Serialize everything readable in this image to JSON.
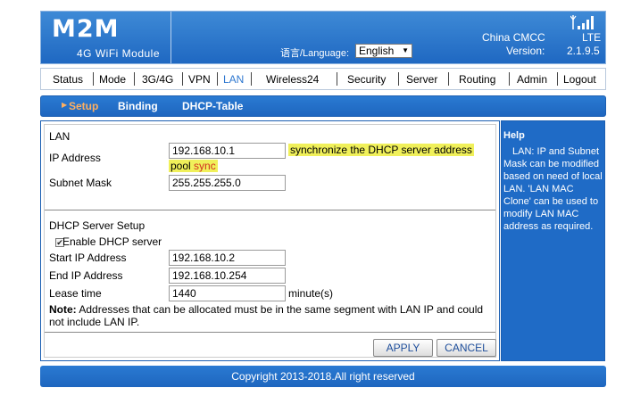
{
  "header": {
    "logo": "M2M",
    "logo_sub": "4G WiFi Module",
    "language_label": "语言/Language:",
    "language_value": "English",
    "carrier": "China CMCC",
    "network_type": "LTE",
    "version_label": "Version:",
    "version_value": "2.1.9.5"
  },
  "nav": {
    "items": [
      "Status",
      "Mode",
      "3G/4G",
      "VPN",
      "LAN",
      "Wireless24",
      "Security",
      "Server",
      "Routing",
      "Admin",
      "Logout"
    ],
    "active": "LAN"
  },
  "subnav": {
    "items": [
      "Setup",
      "Binding",
      "DHCP-Table"
    ],
    "active": "Setup"
  },
  "lan": {
    "section_title": "LAN",
    "ip_label": "IP Address",
    "ip_value": "192.168.10.1",
    "sync_msg_part1": "synchronize the DHCP server address",
    "sync_msg_part2": "pool",
    "sync_link": "sync",
    "mask_label": "Subnet Mask",
    "mask_value": "255.255.255.0"
  },
  "dhcp": {
    "section_title": "DHCP Server Setup",
    "enable_label": "Enable DHCP server",
    "enabled": true,
    "start_label": "Start IP Address",
    "start_value": "192.168.10.2",
    "end_label": "End IP Address",
    "end_value": "192.168.10.254",
    "lease_label": "Lease time",
    "lease_value": "1440",
    "lease_unit": "minute(s)",
    "note_label": "Note:",
    "note_line1": " Addresses that can be allocated must be in the same segment with LAN IP and could",
    "note_line2": "not include LAN IP."
  },
  "buttons": {
    "apply": "APPLY",
    "cancel": "CANCEL"
  },
  "help": {
    "title": "Help",
    "body": "LAN: IP and Subnet Mask can be modified based on need of local LAN. 'LAN MAC Clone' can be used to modify LAN MAC address as required."
  },
  "footer": {
    "copyright": "Copyright 2013-2018.All right reserved"
  },
  "colors": {
    "brand_blue": "#1f6bc6",
    "highlight_yellow": "#f0f05a",
    "link_red": "#d23020",
    "active_orange": "#ffb060"
  }
}
